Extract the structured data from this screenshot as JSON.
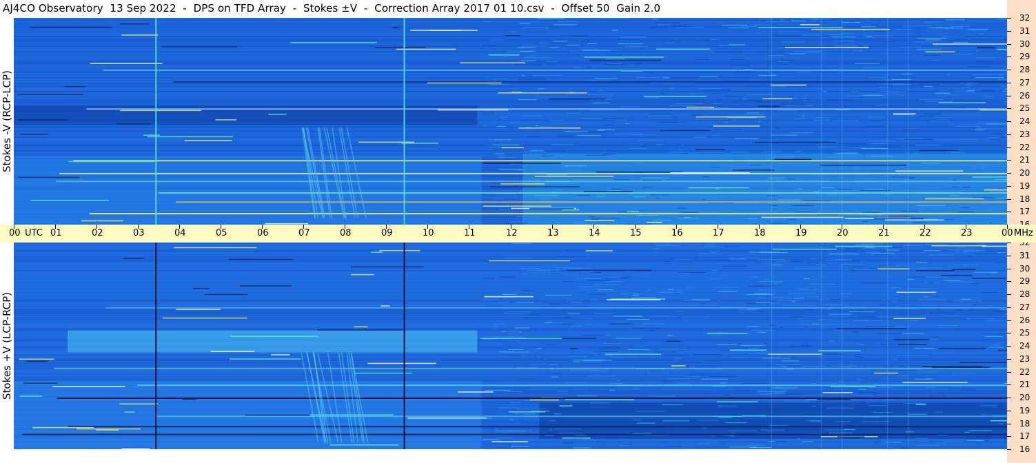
{
  "title": "AJ4CO Observatory  13 Sep 2022  -  DPS on TFD Array  -  Stokes ±V  -  Correction Array 2017 01 10.csv  -  Offset 50  Gain 2.0",
  "chart_data": {
    "type": "heatmap",
    "title": "AJ4CO Observatory  13 Sep 2022  -  DPS on TFD Array  -  Stokes ±V  -  Correction Array 2017 01 10.csv  -  Offset 50  Gain 2.0",
    "x_axis": {
      "unit_label": "UTC",
      "range_hours": [
        0,
        24
      ],
      "tick_labels": [
        "00",
        "01",
        "02",
        "03",
        "04",
        "05",
        "06",
        "07",
        "08",
        "09",
        "10",
        "11",
        "12",
        "13",
        "14",
        "15",
        "16",
        "17",
        "18",
        "19",
        "20",
        "21",
        "22",
        "23",
        "00"
      ]
    },
    "y_axis": {
      "unit_label": "MHz",
      "range_mhz": [
        16,
        32
      ],
      "tick_labels": [
        "16",
        "17",
        "18",
        "19",
        "20",
        "21",
        "22",
        "23",
        "24",
        "25",
        "26",
        "27",
        "28",
        "29",
        "30",
        "31",
        "32"
      ]
    },
    "panels": [
      {
        "ylabel": "Stokes -V (RCP-LCP)",
        "polarity": "negative"
      },
      {
        "ylabel": "Stokes +V (LCP-RCP)",
        "polarity": "positive"
      }
    ],
    "colors": {
      "background_blue": "#1b63d8",
      "time_axis_bg": "#fdfbc2",
      "freq_axis_bg": "#fddfc6"
    }
  }
}
